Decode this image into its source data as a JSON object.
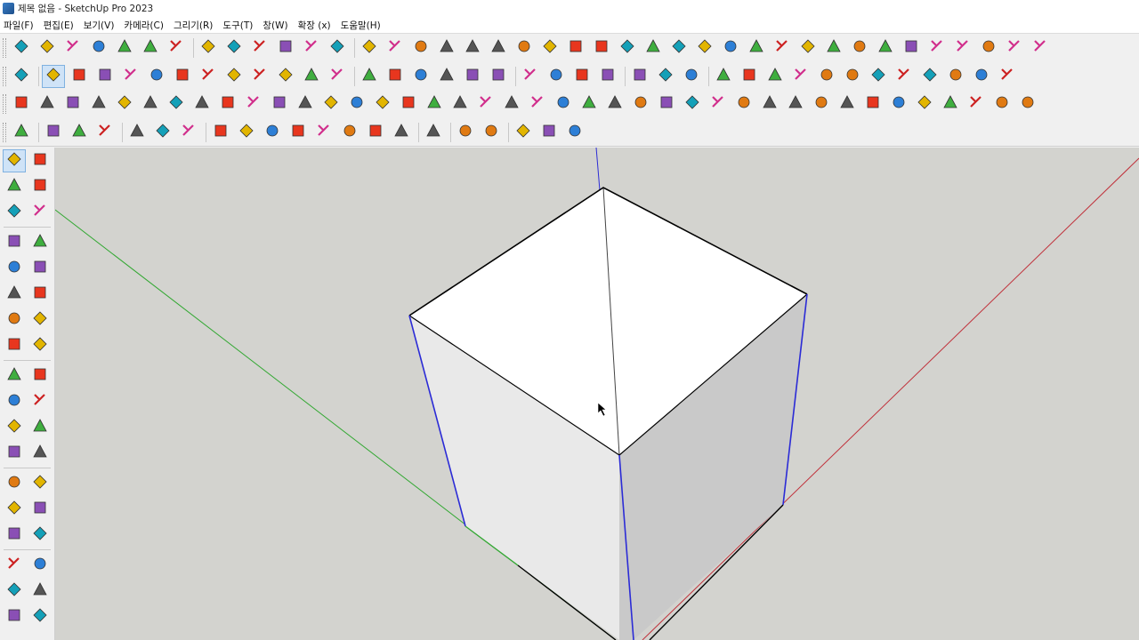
{
  "window": {
    "title": "제목 없음 - SketchUp Pro 2023"
  },
  "menu": [
    {
      "label": "파일(F)"
    },
    {
      "label": "편집(E)"
    },
    {
      "label": "보기(V)"
    },
    {
      "label": "카메라(C)"
    },
    {
      "label": "그리기(R)"
    },
    {
      "label": "도구(T)"
    },
    {
      "label": "창(W)"
    },
    {
      "label": "확장 (x)"
    },
    {
      "label": "도움말(H)"
    }
  ],
  "colors": {
    "viewport_bg": "#d3d3cf",
    "axis_red": "#c0303a",
    "axis_green": "#33a833",
    "axis_blue": "#2b2bd6",
    "face_top": "#ffffff",
    "face_left": "#e9e9e9",
    "face_right": "#c9c9c9",
    "accent_selected": "#cfe3f7"
  },
  "toolbar_icons": {
    "row1": [
      "component-icon",
      "door-icon",
      "home-icon",
      "front-view-icon",
      "back-view-icon",
      "house-outline-icon",
      "square-outline-icon",
      "layer-blue-icon",
      "layer-cyan-icon",
      "layer-yellow-icon",
      "layer-green-icon",
      "layer-red-icon",
      "layer-white-icon",
      "undo-icon",
      "red-square-icon",
      "window-icon",
      "flag-icon",
      "ruler-icon",
      "link-icon",
      "arc-icon",
      "dots-icon",
      "red-cross-icon",
      "green-cross-icon",
      "x-tool-icon",
      "cone-icon",
      "cone2-icon",
      "warning-icon",
      "rotate-icon",
      "rotate2-icon",
      "rotate3-icon",
      "star-icon",
      "box-icon",
      "magnet-icon",
      "move-icon",
      "red-arrow-icon",
      "shield-icon",
      "gear-icon",
      "grid-icon",
      "tile-orange-icon",
      "tile-yellow-icon"
    ],
    "row2": [
      "zoom-icon",
      "select-icon",
      "eraser-icon",
      "pencil-icon",
      "arc-tool-icon",
      "rectangle-icon",
      "push-pull-icon",
      "follow-me-icon",
      "move-tool-icon",
      "rotate-tool-icon",
      "scale-icon",
      "offset-icon",
      "tape-measure-icon",
      "paint-bucket-icon",
      "orbit-icon",
      "pan-icon",
      "zoom-window-icon",
      "zoom-extents-icon",
      "section-icon",
      "sandbox-icon",
      "stamp-icon",
      "drape-icon",
      "user-icon",
      "knife-icon",
      "chair-icon",
      "bird-icon",
      "fill-icon",
      "paint-icon",
      "wave-icon",
      "hook-icon",
      "balance-icon",
      "cube-yellow-icon",
      "cube-cyan-icon",
      "bar-blue-icon",
      "arrows-blue-icon",
      "arrows-red-icon",
      "diagonal-icon",
      "hourglass-icon"
    ],
    "row3": [
      "vertex-icon",
      "add-point-icon",
      "curve-icon",
      "plug-icon",
      "stack-icon",
      "stack2-icon",
      "scissors-icon",
      "cut-icon",
      "tree-icon",
      "hand-icon",
      "helmet-icon",
      "pipe-icon",
      "box3-icon",
      "ball-icon",
      "bracket-icon",
      "bracket2-icon",
      "diagonal2-icon",
      "triangle-icon",
      "bracket3-icon",
      "sketch-icon",
      "lines-icon",
      "lines2-icon",
      "wave2-icon",
      "ruler2-icon",
      "palm-icon",
      "corner-icon",
      "fold-icon",
      "fold2-icon",
      "arrow-down-icon",
      "shears-icon",
      "chevrons-icon",
      "hatch-icon",
      "bracket4-icon",
      "hatch2-icon",
      "hatch3-icon",
      "hatch4-icon",
      "hatch5-icon",
      "hatch6-icon",
      "stripes-icon",
      "stripes2-icon"
    ],
    "row4": [
      "view-frame-icon",
      "sphere-icon",
      "spray-icon",
      "ribbon-icon",
      "solid-yellow-icon",
      "solid-grey-icon",
      "solid-green-icon",
      "axis-push-icon",
      "axis-j-icon",
      "axis-i-icon",
      "axis-r-icon",
      "axis-y-icon",
      "axis-n-icon",
      "axis-x-icon",
      "axis-f-icon",
      "sketch-logo-icon",
      "play-icon",
      "stop-icon",
      "scene-icon",
      "camera-icon",
      "settings-gear-icon"
    ]
  },
  "left_tools": [
    [
      "select-icon",
      "orbit-icon"
    ],
    [
      "paint-bucket-icon",
      "eraser-icon"
    ],
    [
      "component-icon",
      "tape-measure-icon"
    ],
    [
      "pencil-icon",
      "freehand-icon"
    ],
    [
      "rectangle-icon",
      "rotated-rectangle-icon"
    ],
    [
      "circle-icon",
      "polygon-icon"
    ],
    [
      "arc-icon",
      "pie-icon"
    ],
    [
      "two-point-arc-icon",
      "three-point-arc-icon"
    ],
    [
      "move-icon",
      "push-pull-icon"
    ],
    [
      "rotate-icon",
      "follow-me-icon"
    ],
    [
      "scale-icon",
      "offset-icon"
    ],
    [
      "axes-icon",
      "section-plane-icon"
    ],
    [
      "tape-icon",
      "dimension-icon"
    ],
    [
      "protractor-icon",
      "text-icon"
    ],
    [
      "axes2-icon",
      "3d-text-icon"
    ],
    [
      "orbit2-icon",
      "pan-icon"
    ],
    [
      "zoom-icon",
      "zoom-window-icon"
    ],
    [
      "zoom-extents-icon",
      "previous-view-icon"
    ]
  ]
}
